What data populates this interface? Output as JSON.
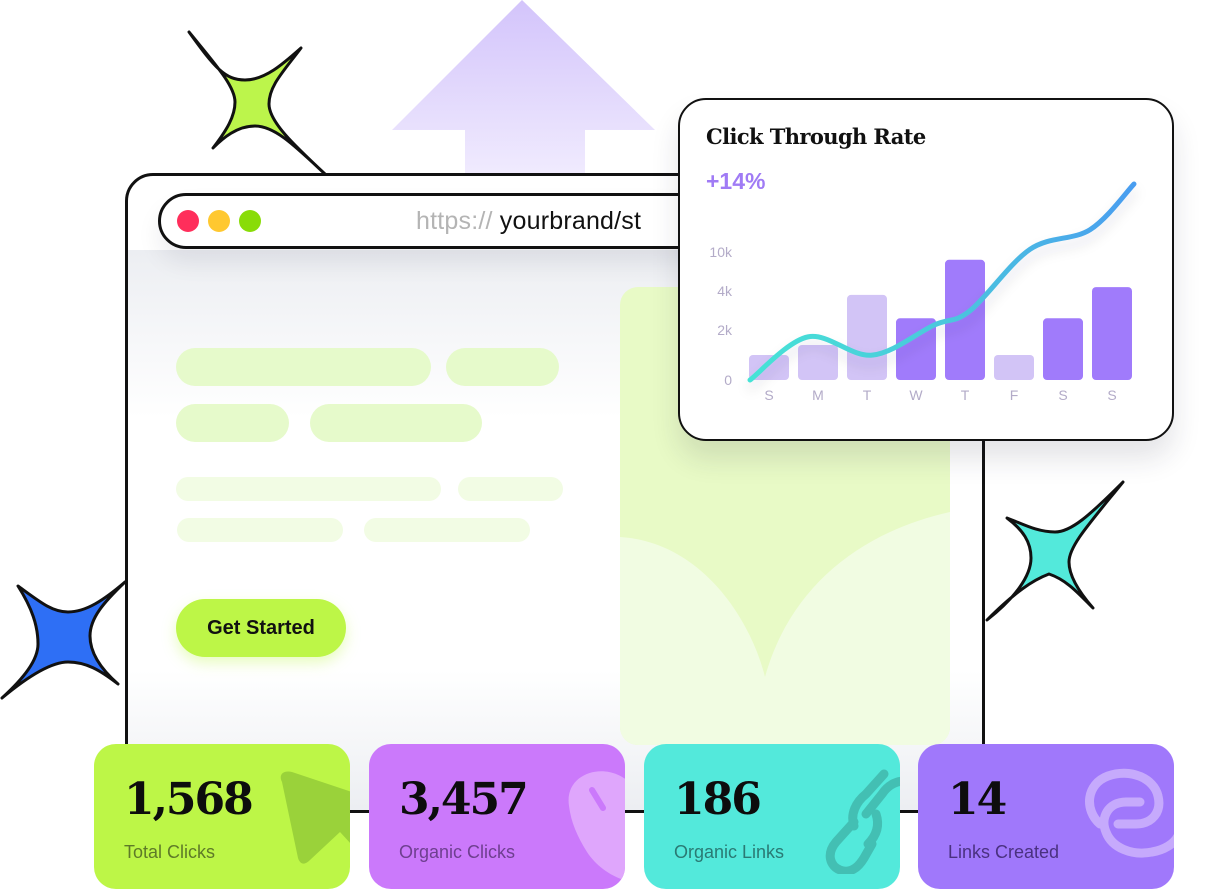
{
  "browser": {
    "url_protocol": "https://",
    "url_host": " yourbrand/st",
    "window_controls": [
      "close",
      "minimize",
      "maximize"
    ],
    "control_colors": {
      "close": "#ff2e5b",
      "minimize": "#ffc830",
      "maximize": "#89dc08"
    }
  },
  "hero": {
    "cta_label": "Get Started"
  },
  "chart_card": {
    "title": "Click Through Rate",
    "delta": "+14%"
  },
  "chart_data": {
    "type": "bar",
    "title": "Click Through Rate",
    "subtitle": "+14%",
    "categories": [
      "S",
      "M",
      "T",
      "W",
      "T",
      "F",
      "S",
      "S"
    ],
    "yticks": [
      "0",
      "2k",
      "4k",
      "10k"
    ],
    "ytick_values": [
      0,
      2000,
      4000,
      10000
    ],
    "series": [
      {
        "name": "clicks",
        "type": "bar",
        "values": [
          1000,
          1400,
          3800,
          2600,
          8800,
          1000,
          2600,
          4600
        ],
        "highlight": [
          false,
          false,
          false,
          true,
          true,
          false,
          true,
          true
        ]
      },
      {
        "name": "trend",
        "type": "line",
        "values": [
          0,
          3300,
          1900,
          4200,
          5300,
          10000,
          11500,
          15000
        ]
      }
    ],
    "xlabel": "",
    "ylabel": "",
    "grid": false,
    "legend": "none",
    "colors": {
      "bar_light": "#d2c4f6",
      "bar_dark": "#a07bfb",
      "line_start": "#45e3d6",
      "line_end": "#4a9df0",
      "tick": "#b3abc8"
    }
  },
  "stats": [
    {
      "value": "1,568",
      "label": "Total Clicks",
      "icon": "cursor-arrow-icon",
      "bg": "#bdf647",
      "label_color": "#5e7a28"
    },
    {
      "value": "3,457",
      "label": "Organic Clicks",
      "icon": "mouse-icon",
      "bg": "#cb79fb",
      "label_color": "#6e3f8f"
    },
    {
      "value": "186",
      "label": "Organic Links",
      "icon": "link-icon",
      "bg": "#53e9db",
      "label_color": "#2a7a74"
    },
    {
      "value": "14",
      "label": "Links Created",
      "icon": "link-swirl-icon",
      "bg": "#a078fb",
      "label_color": "#4a3180"
    }
  ]
}
